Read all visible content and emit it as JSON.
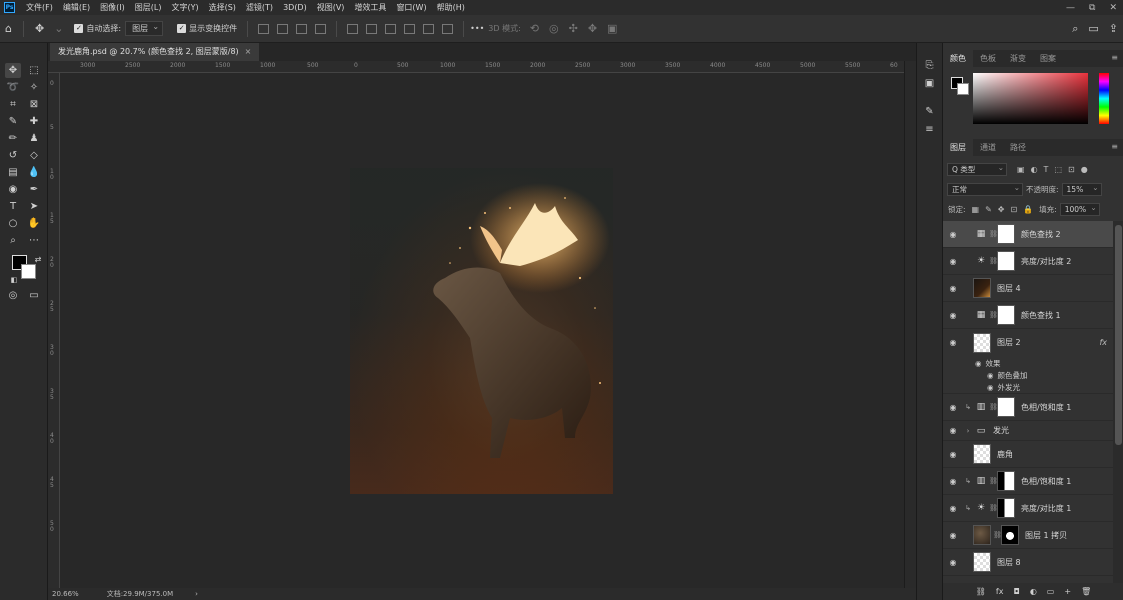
{
  "menubar": {
    "logo": "Ps",
    "items": [
      "文件(F)",
      "编辑(E)",
      "图像(I)",
      "图层(L)",
      "文字(Y)",
      "选择(S)",
      "滤镜(T)",
      "3D(D)",
      "视图(V)",
      "增效工具",
      "窗口(W)",
      "帮助(H)"
    ],
    "win": {
      "min": "—",
      "restore": "⧉",
      "close": "✕"
    }
  },
  "options": {
    "auto_select_label": "自动选择:",
    "auto_select_value": "图层",
    "show_transform_label": "显示变换控件",
    "mode_3d_label": "3D 模式:",
    "more": "•••"
  },
  "document": {
    "tab_title": "发光鹿角.psd @ 20.7% (颜色查找 2, 图层蒙版/8)",
    "close": "×"
  },
  "ruler": {
    "top": [
      "3000",
      "2500",
      "2000",
      "1500",
      "1000",
      "500",
      "0",
      "500",
      "1000",
      "1500",
      "2000",
      "2500",
      "3000",
      "3500",
      "4000",
      "4500",
      "5000",
      "5500",
      "60"
    ],
    "left": [
      "0",
      "5",
      "1 0",
      "1 5",
      "2 0",
      "2 5",
      "3 0",
      "3 5",
      "4 0",
      "4 5",
      "5 0"
    ]
  },
  "status": {
    "zoom": "20.66%",
    "doc": "文档:29.9M/375.0M",
    "arrow": "›"
  },
  "panels": {
    "color_tabs": [
      "颜色",
      "色板",
      "渐变",
      "图案"
    ],
    "layer_tabs": [
      "图层",
      "通道",
      "路径"
    ],
    "filter_kind": "Q 类型",
    "blend_mode": "正常",
    "opacity_label": "不透明度:",
    "opacity_value": "15%",
    "lock_label": "锁定:",
    "fill_label": "填充:",
    "fill_value": "100%"
  },
  "layers": [
    {
      "name": "颜色查找 2",
      "icon": "table-icon",
      "thumb": "white",
      "selected": true
    },
    {
      "name": "亮度/对比度 2",
      "icon": "sun-icon",
      "thumb": "white"
    },
    {
      "name": "图层 4",
      "thumb": "photo"
    },
    {
      "name": "颜色查找 1",
      "icon": "table-icon",
      "thumb": "white"
    },
    {
      "name": "图层 2",
      "thumb": "checker",
      "fx": "fx"
    },
    {
      "name": "效果",
      "sub": true
    },
    {
      "name": "颜色叠加",
      "sub": true
    },
    {
      "name": "外发光",
      "sub": true
    },
    {
      "name": "色相/饱和度 1",
      "icon": "hue-icon",
      "thumb": "white",
      "clipped": true
    },
    {
      "name": "发光",
      "folder": true
    },
    {
      "name": "鹿角",
      "thumb": "checker"
    },
    {
      "name": "色相/饱和度 1",
      "icon": "hue-icon",
      "thumb": "mask2",
      "clipped": true
    },
    {
      "name": "亮度/对比度 1",
      "icon": "sun-icon",
      "thumb": "mask2",
      "clipped": true
    },
    {
      "name": "图层 1 拷贝",
      "thumb": "deer"
    },
    {
      "name": "图层 8",
      "thumb": "checker"
    }
  ],
  "footer_icons": [
    "⛓",
    "fx",
    "◘",
    "◐",
    "▭",
    "+",
    "🗑"
  ]
}
